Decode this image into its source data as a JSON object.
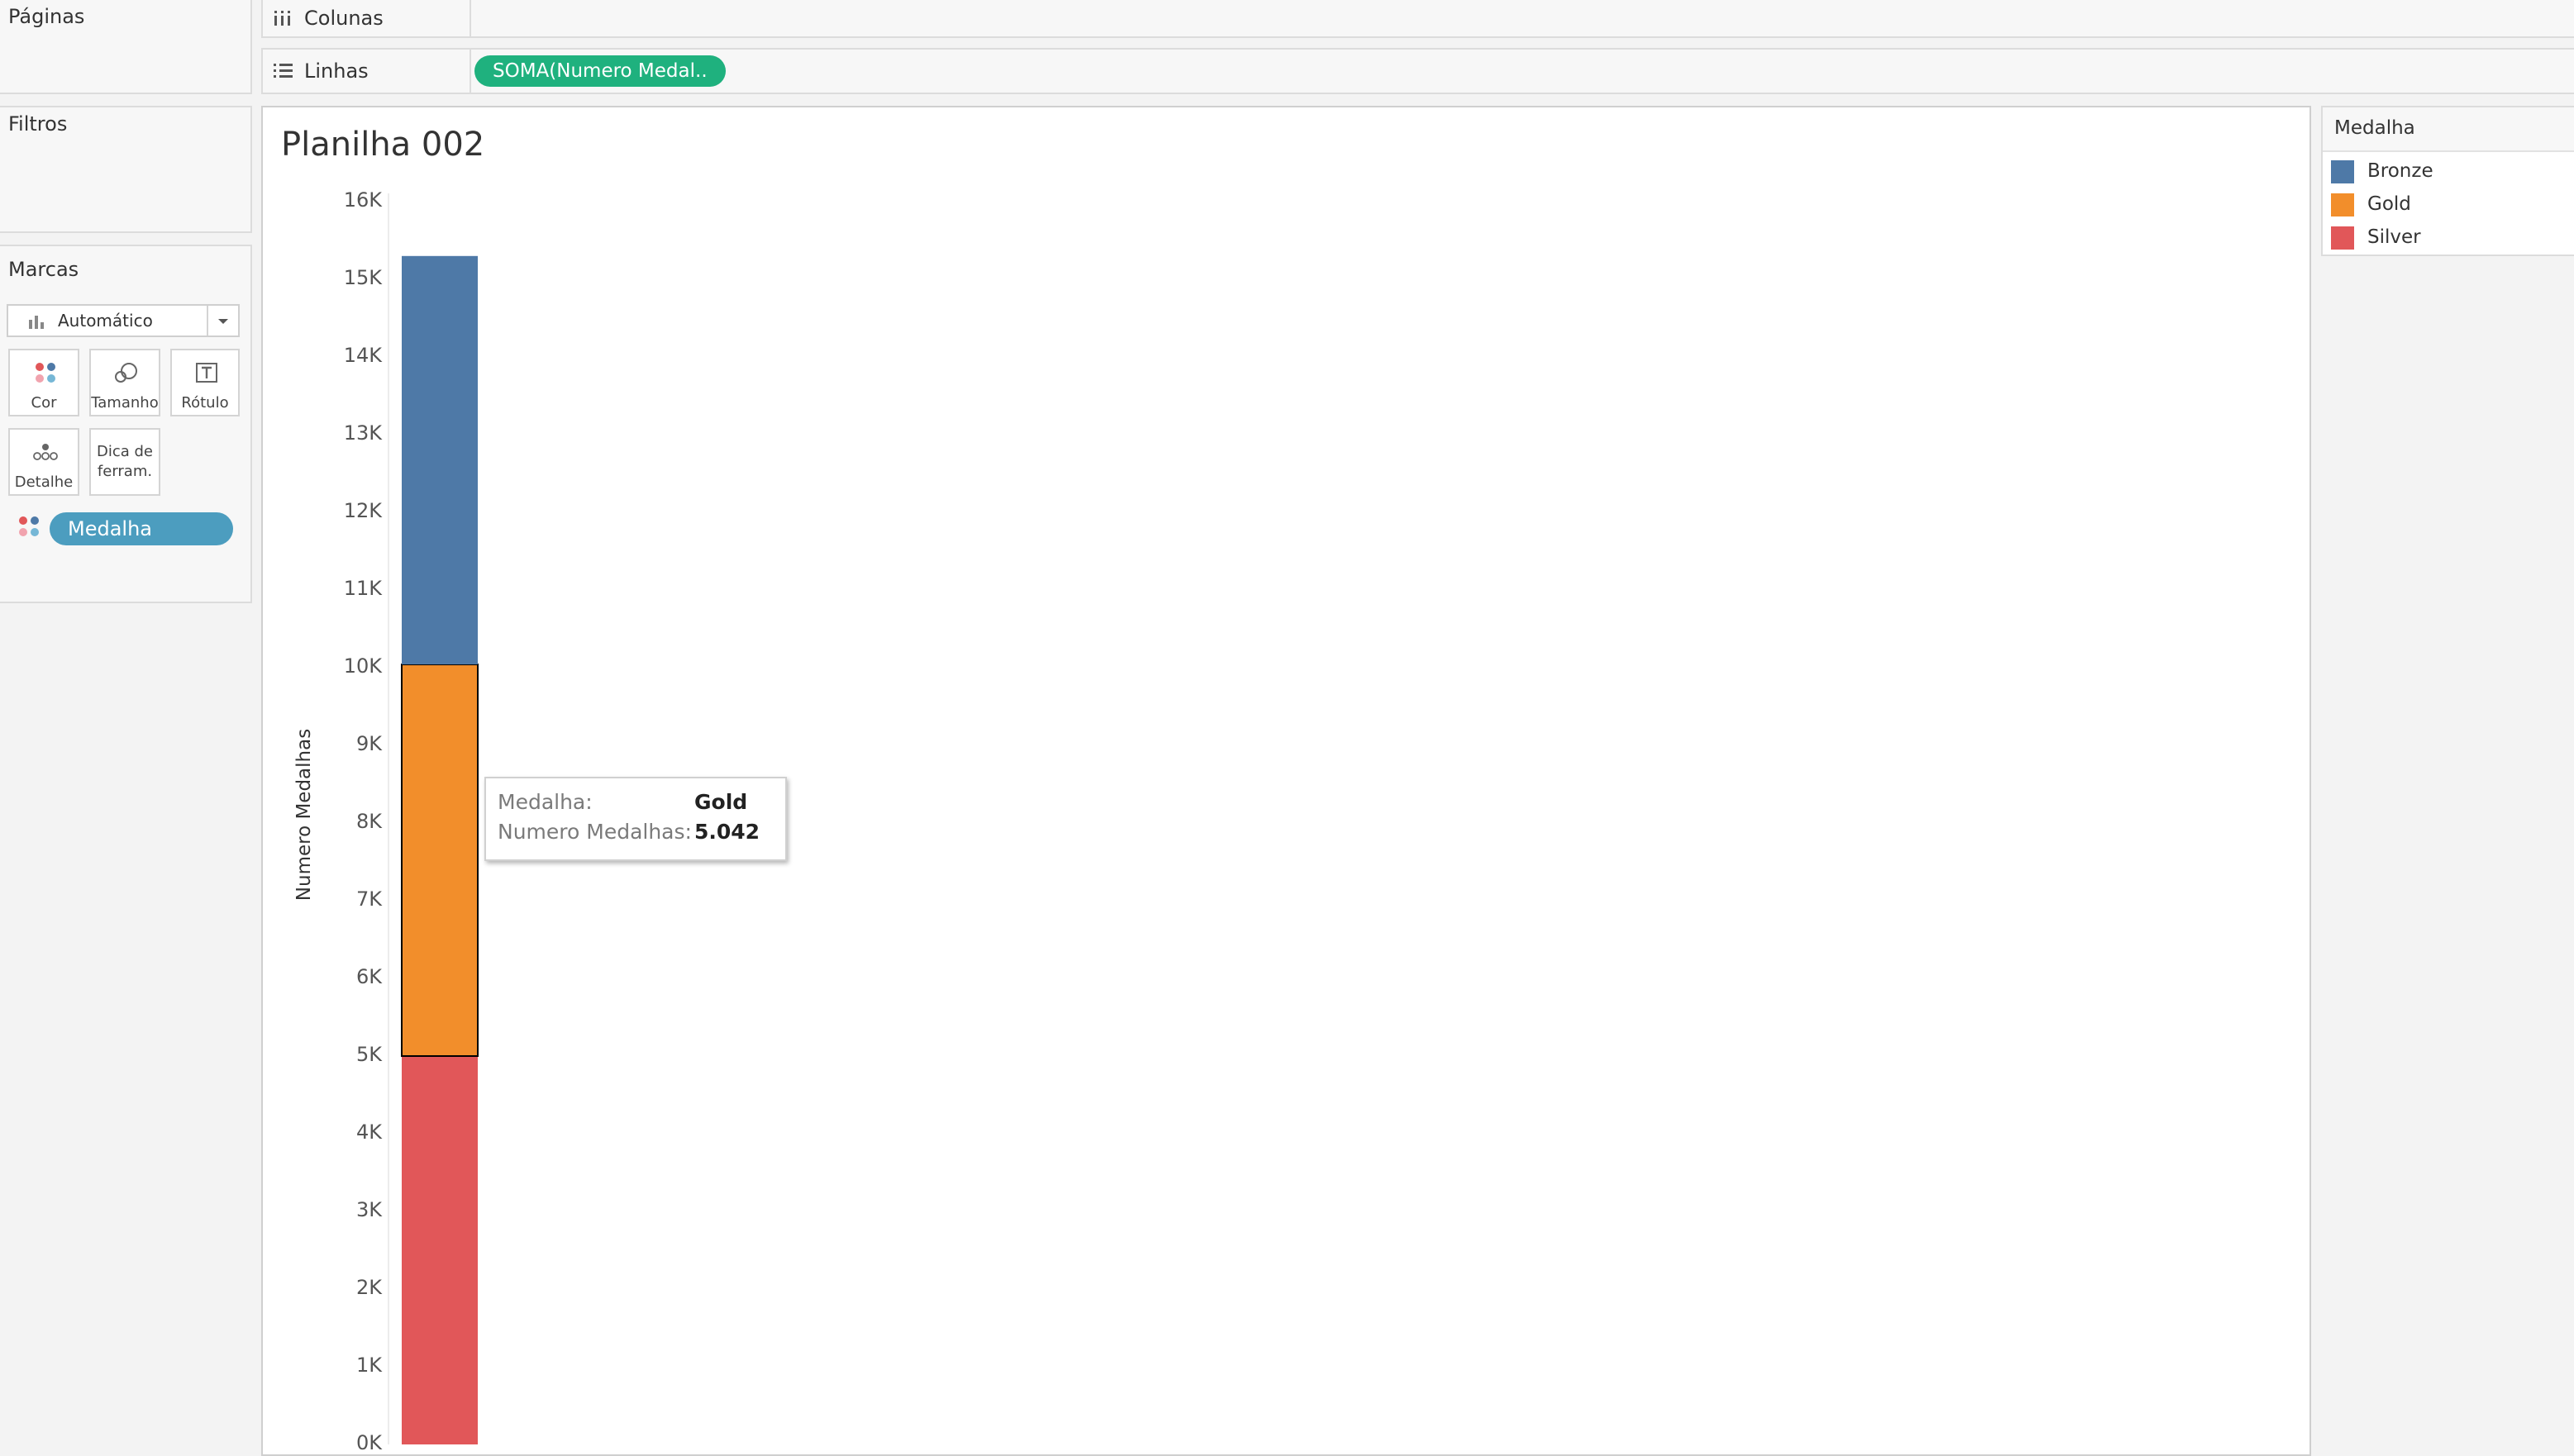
{
  "left_panel": {
    "pages_title": "Páginas",
    "filters_title": "Filtros",
    "marks_title": "Marcas",
    "mark_type": "Automático",
    "mark_buttons": {
      "color": "Cor",
      "size": "Tamanho",
      "label": "Rótulo",
      "detail": "Detalhe",
      "tooltip_line1": "Dica de",
      "tooltip_line2": "ferram."
    },
    "color_field_pill": "Medalha"
  },
  "shelves": {
    "columns_label": "Colunas",
    "rows_label": "Linhas",
    "rows_pill": "SOMA(Numero Medal.."
  },
  "sheet": {
    "title": "Planilha 002"
  },
  "legend": {
    "title": "Medalha",
    "items": [
      {
        "label": "Bronze",
        "color": "#4e79a7"
      },
      {
        "label": "Gold",
        "color": "#f28e2b"
      },
      {
        "label": "Silver",
        "color": "#e15759"
      }
    ]
  },
  "tooltip": {
    "rows": [
      {
        "key": "Medalha:",
        "value": "Gold"
      },
      {
        "key": "Numero Medalhas:",
        "value": "5.042"
      }
    ]
  },
  "chart_data": {
    "type": "bar",
    "stacked": true,
    "ylabel": "Numero Medalhas",
    "ylim": [
      0,
      16000
    ],
    "y_ticks": [
      "0K",
      "1K",
      "2K",
      "3K",
      "4K",
      "5K",
      "6K",
      "7K",
      "8K",
      "9K",
      "10K",
      "11K",
      "12K",
      "13K",
      "14K",
      "15K",
      "16K"
    ],
    "series": [
      {
        "name": "Silver",
        "value": 5000,
        "color": "#e15759"
      },
      {
        "name": "Gold",
        "value": 5042,
        "color": "#f28e2b"
      },
      {
        "name": "Bronze",
        "value": 5258,
        "color": "#4e79a7"
      }
    ],
    "highlighted_series": "Gold"
  }
}
